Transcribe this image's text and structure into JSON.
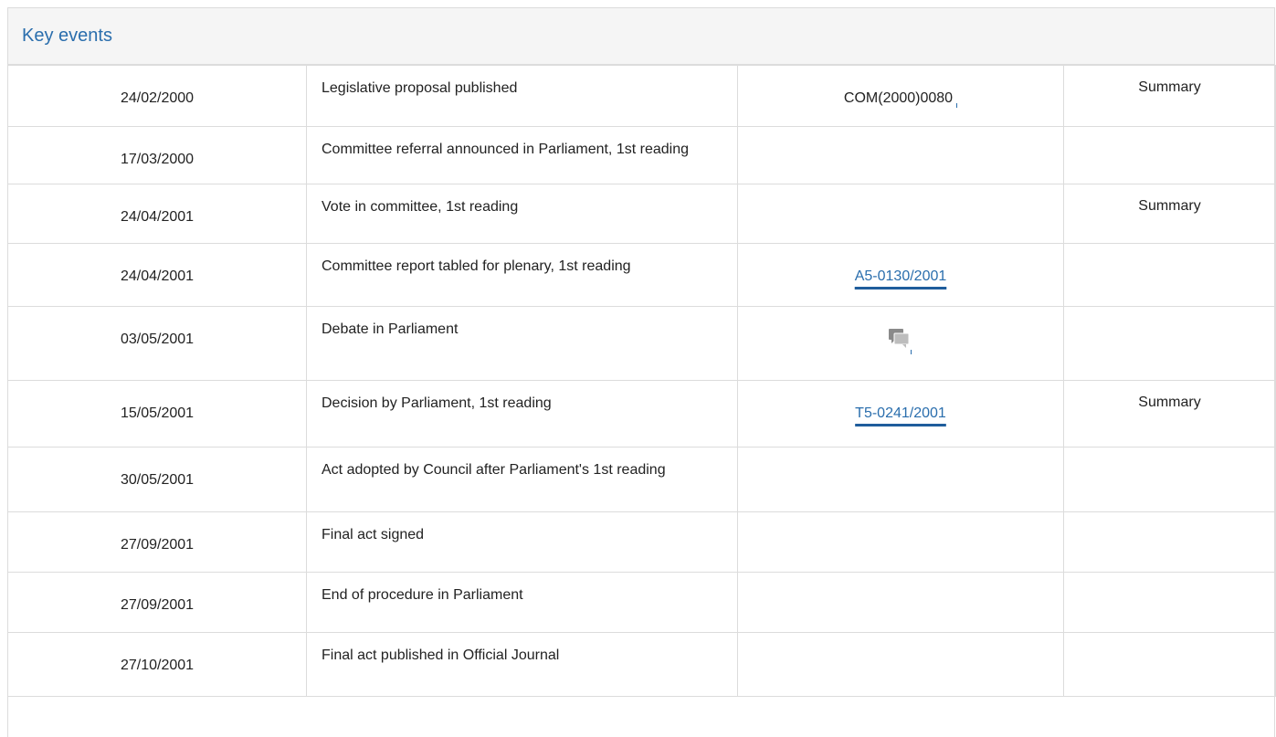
{
  "panel": {
    "title": "Key events"
  },
  "rows": [
    {
      "date": "24/02/2000",
      "event": "Legislative proposal published",
      "ref": "COM(2000)0080",
      "ref_type": "plain",
      "summary": "Summary"
    },
    {
      "date": "17/03/2000",
      "event": "Committee referral announced in Parliament, 1st reading",
      "ref": "",
      "ref_type": "none",
      "summary": ""
    },
    {
      "date": "24/04/2001",
      "event": "Vote in committee, 1st reading",
      "ref": "",
      "ref_type": "none",
      "summary": "Summary"
    },
    {
      "date": "24/04/2001",
      "event": "Committee report tabled for plenary, 1st reading",
      "ref": "A5-0130/2001",
      "ref_type": "link",
      "summary": ""
    },
    {
      "date": "03/05/2001",
      "event": "Debate in Parliament",
      "ref": "",
      "ref_type": "icon",
      "icon": "debate-speech-bubbles-icon",
      "summary": ""
    },
    {
      "date": "15/05/2001",
      "event": "Decision by Parliament, 1st reading",
      "ref": "T5-0241/2001",
      "ref_type": "link",
      "summary": "Summary"
    },
    {
      "date": "30/05/2001",
      "event": "Act adopted by Council after Parliament's 1st reading",
      "ref": "",
      "ref_type": "none",
      "summary": ""
    },
    {
      "date": "27/09/2001",
      "event": "Final act signed",
      "ref": "",
      "ref_type": "none",
      "summary": ""
    },
    {
      "date": "27/09/2001",
      "event": "End of procedure in Parliament",
      "ref": "",
      "ref_type": "none",
      "summary": ""
    },
    {
      "date": "27/10/2001",
      "event": "Final act published in Official Journal",
      "ref": "",
      "ref_type": "none",
      "summary": ""
    }
  ],
  "colors": {
    "link": "#2a6ead",
    "border": "#dcdcdc",
    "header_bg": "#f5f5f5"
  }
}
